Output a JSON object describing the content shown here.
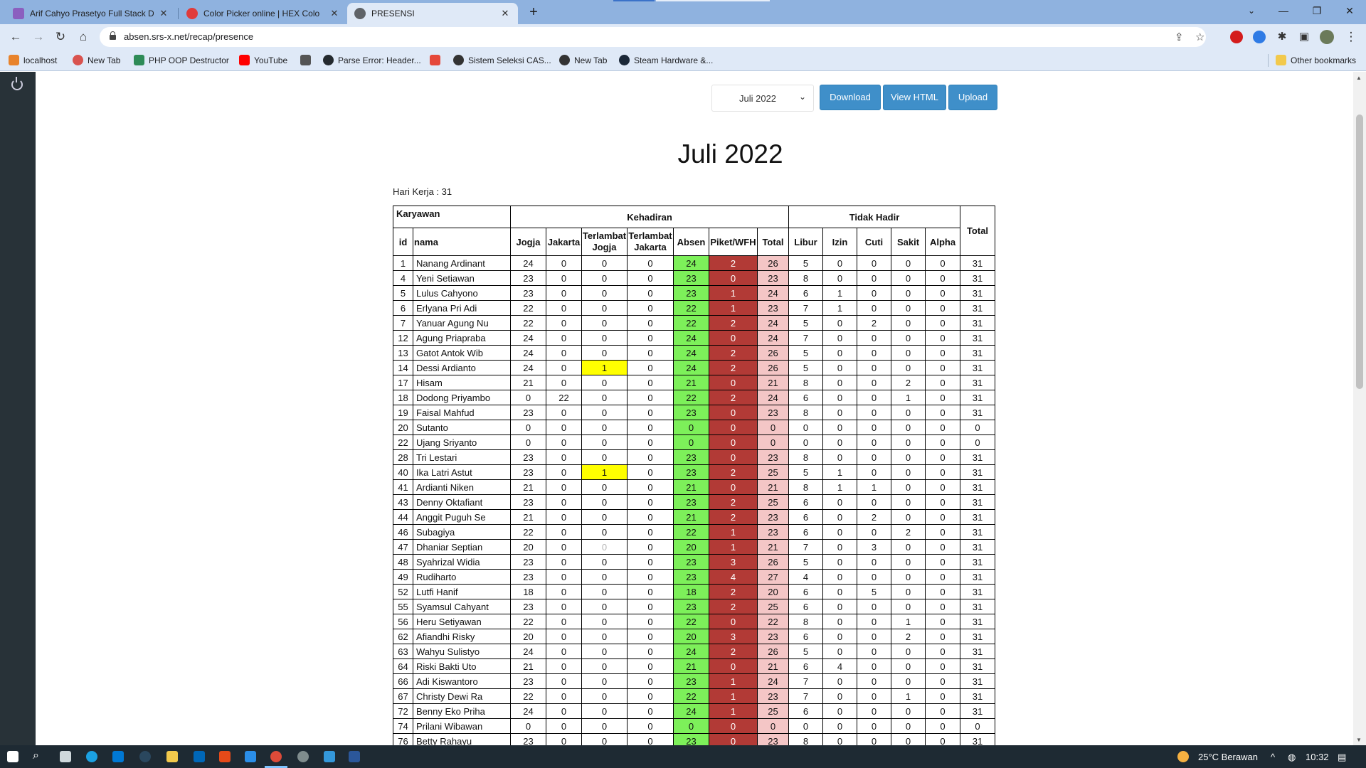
{
  "browser": {
    "tabs": [
      {
        "title": "Arif Cahyo Prasetyo Full Stack De",
        "favicon_color": "#8b5fbf"
      },
      {
        "title": "Color Picker online | HEX Colo",
        "favicon_color": "#e03b3b"
      },
      {
        "title": "PRESENSI",
        "favicon_color": "#5f6368"
      }
    ],
    "new_tab_icon": "plus-icon",
    "url": "absen.srs-x.net/recap/presence",
    "bookmarks": [
      {
        "label": "localhost",
        "color": "#e8832c"
      },
      {
        "label": "New Tab",
        "color": "#d9534f"
      },
      {
        "label": "PHP OOP Destructor",
        "color": "#2e8b57"
      },
      {
        "label": "YouTube",
        "color": "#ff0000"
      },
      {
        "label": "",
        "color": "#555555"
      },
      {
        "label": "Parse Error: Header...",
        "color": "#24292e"
      },
      {
        "label": "",
        "color": "#e5483a"
      },
      {
        "label": "Sistem Seleksi CAS...",
        "color": "#333333"
      },
      {
        "label": "New Tab",
        "color": "#333333"
      },
      {
        "label": "Steam Hardware &...",
        "color": "#1b2838"
      }
    ],
    "other_bookmarks": "Other bookmarks"
  },
  "controls": {
    "month_selected": "Juli 2022",
    "download_label": "Download",
    "view_html_label": "View HTML",
    "upload_label": "Upload"
  },
  "page_title": "Juli 2022",
  "work_days": "Hari Kerja : 31",
  "table": {
    "group_headers": {
      "karyawan": "Karyawan",
      "kehadiran": "Kehadiran",
      "tidak_hadir": "Tidak Hadir",
      "total": "Total"
    },
    "columns": [
      "id",
      "nama",
      "Jogja",
      "Jakarta",
      "Terlambat Jogja",
      "Terlambat Jakarta",
      "Absen",
      "Piket/WFH",
      "Total",
      "Libur",
      "Izin",
      "Cuti",
      "Sakit",
      "Alpha"
    ],
    "rows": [
      [
        "1",
        "Nanang Ardinant",
        "24",
        "0",
        "0",
        "0",
        "24",
        "2",
        "26",
        "5",
        "0",
        "0",
        "0",
        "0",
        "31"
      ],
      [
        "4",
        "Yeni Setiawan",
        "23",
        "0",
        "0",
        "0",
        "23",
        "0",
        "23",
        "8",
        "0",
        "0",
        "0",
        "0",
        "31"
      ],
      [
        "5",
        "Lulus Cahyono",
        "23",
        "0",
        "0",
        "0",
        "23",
        "1",
        "24",
        "6",
        "1",
        "0",
        "0",
        "0",
        "31"
      ],
      [
        "6",
        "Erlyana Pri Adi",
        "22",
        "0",
        "0",
        "0",
        "22",
        "1",
        "23",
        "7",
        "1",
        "0",
        "0",
        "0",
        "31"
      ],
      [
        "7",
        "Yanuar Agung Nu",
        "22",
        "0",
        "0",
        "0",
        "22",
        "2",
        "24",
        "5",
        "0",
        "2",
        "0",
        "0",
        "31"
      ],
      [
        "12",
        "Agung Priapraba",
        "24",
        "0",
        "0",
        "0",
        "24",
        "0",
        "24",
        "7",
        "0",
        "0",
        "0",
        "0",
        "31"
      ],
      [
        "13",
        "Gatot Antok Wib",
        "24",
        "0",
        "0",
        "0",
        "24",
        "2",
        "26",
        "5",
        "0",
        "0",
        "0",
        "0",
        "31"
      ],
      [
        "14",
        "Dessi Ardianto",
        "24",
        "0",
        "1",
        "0",
        "24",
        "2",
        "26",
        "5",
        "0",
        "0",
        "0",
        "0",
        "31"
      ],
      [
        "17",
        "Hisam",
        "21",
        "0",
        "0",
        "0",
        "21",
        "0",
        "21",
        "8",
        "0",
        "0",
        "2",
        "0",
        "31"
      ],
      [
        "18",
        "Dodong Priyambo",
        "0",
        "22",
        "0",
        "0",
        "22",
        "2",
        "24",
        "6",
        "0",
        "0",
        "1",
        "0",
        "31"
      ],
      [
        "19",
        "Faisal Mahfud",
        "23",
        "0",
        "0",
        "0",
        "23",
        "0",
        "23",
        "8",
        "0",
        "0",
        "0",
        "0",
        "31"
      ],
      [
        "20",
        "Sutanto",
        "0",
        "0",
        "0",
        "0",
        "0",
        "0",
        "0",
        "0",
        "0",
        "0",
        "0",
        "0",
        "0"
      ],
      [
        "22",
        "Ujang Sriyanto",
        "0",
        "0",
        "0",
        "0",
        "0",
        "0",
        "0",
        "0",
        "0",
        "0",
        "0",
        "0",
        "0"
      ],
      [
        "28",
        "Tri Lestari",
        "23",
        "0",
        "0",
        "0",
        "23",
        "0",
        "23",
        "8",
        "0",
        "0",
        "0",
        "0",
        "31"
      ],
      [
        "40",
        "Ika Latri Astut",
        "23",
        "0",
        "1",
        "0",
        "23",
        "2",
        "25",
        "5",
        "1",
        "0",
        "0",
        "0",
        "31"
      ],
      [
        "41",
        "Ardianti Niken",
        "21",
        "0",
        "0",
        "0",
        "21",
        "0",
        "21",
        "8",
        "1",
        "1",
        "0",
        "0",
        "31"
      ],
      [
        "43",
        "Denny Oktafiant",
        "23",
        "0",
        "0",
        "0",
        "23",
        "2",
        "25",
        "6",
        "0",
        "0",
        "0",
        "0",
        "31"
      ],
      [
        "44",
        "Anggit Puguh Se",
        "21",
        "0",
        "0",
        "0",
        "21",
        "2",
        "23",
        "6",
        "0",
        "2",
        "0",
        "0",
        "31"
      ],
      [
        "46",
        "Subagiya",
        "22",
        "0",
        "0",
        "0",
        "22",
        "1",
        "23",
        "6",
        "0",
        "0",
        "2",
        "0",
        "31"
      ],
      [
        "47",
        "Dhaniar Septian",
        "20",
        "0",
        "0",
        "0",
        "20",
        "1",
        "21",
        "7",
        "0",
        "3",
        "0",
        "0",
        "31"
      ],
      [
        "48",
        "Syahrizal Widia",
        "23",
        "0",
        "0",
        "0",
        "23",
        "3",
        "26",
        "5",
        "0",
        "0",
        "0",
        "0",
        "31"
      ],
      [
        "49",
        "Rudiharto",
        "23",
        "0",
        "0",
        "0",
        "23",
        "4",
        "27",
        "4",
        "0",
        "0",
        "0",
        "0",
        "31"
      ],
      [
        "52",
        "Lutfi Hanif",
        "18",
        "0",
        "0",
        "0",
        "18",
        "2",
        "20",
        "6",
        "0",
        "5",
        "0",
        "0",
        "31"
      ],
      [
        "55",
        "Syamsul Cahyant",
        "23",
        "0",
        "0",
        "0",
        "23",
        "2",
        "25",
        "6",
        "0",
        "0",
        "0",
        "0",
        "31"
      ],
      [
        "56",
        "Heru Setiyawan",
        "22",
        "0",
        "0",
        "0",
        "22",
        "0",
        "22",
        "8",
        "0",
        "0",
        "1",
        "0",
        "31"
      ],
      [
        "62",
        "Afiandhi Risky",
        "20",
        "0",
        "0",
        "0",
        "20",
        "3",
        "23",
        "6",
        "0",
        "0",
        "2",
        "0",
        "31"
      ],
      [
        "63",
        "Wahyu Sulistyo",
        "24",
        "0",
        "0",
        "0",
        "24",
        "2",
        "26",
        "5",
        "0",
        "0",
        "0",
        "0",
        "31"
      ],
      [
        "64",
        "Riski Bakti Uto",
        "21",
        "0",
        "0",
        "0",
        "21",
        "0",
        "21",
        "6",
        "4",
        "0",
        "0",
        "0",
        "31"
      ],
      [
        "66",
        "Adi Kiswantoro",
        "23",
        "0",
        "0",
        "0",
        "23",
        "1",
        "24",
        "7",
        "0",
        "0",
        "0",
        "0",
        "31"
      ],
      [
        "67",
        "Christy Dewi Ra",
        "22",
        "0",
        "0",
        "0",
        "22",
        "1",
        "23",
        "7",
        "0",
        "0",
        "1",
        "0",
        "31"
      ],
      [
        "72",
        "Benny Eko Priha",
        "24",
        "0",
        "0",
        "0",
        "24",
        "1",
        "25",
        "6",
        "0",
        "0",
        "0",
        "0",
        "31"
      ],
      [
        "74",
        "Prilani Wibawan",
        "0",
        "0",
        "0",
        "0",
        "0",
        "0",
        "0",
        "0",
        "0",
        "0",
        "0",
        "0",
        "0"
      ],
      [
        "76",
        "Betty Rahayu",
        "23",
        "0",
        "0",
        "0",
        "23",
        "0",
        "23",
        "8",
        "0",
        "0",
        "0",
        "0",
        "31"
      ]
    ],
    "highlight_late": [
      [
        "14",
        4
      ],
      [
        "40",
        4
      ]
    ],
    "muted_cells": [
      [
        "47",
        4
      ]
    ],
    "colors": {
      "absen": "#7df05a",
      "piket": "#b23a36",
      "total": "#f4c6c6",
      "late": "#ffff00"
    }
  },
  "taskbar": {
    "weather": "25°C  Berawan",
    "time": "10:32"
  }
}
